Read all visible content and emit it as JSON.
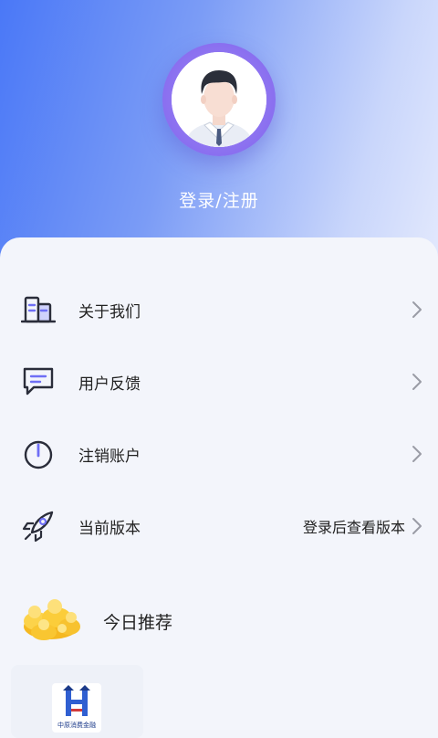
{
  "profile": {
    "login_label": "登录/注册"
  },
  "menu": {
    "items": [
      {
        "label": "关于我们",
        "icon": "building-icon"
      },
      {
        "label": "用户反馈",
        "icon": "chat-icon"
      },
      {
        "label": "注销账户",
        "icon": "power-icon"
      },
      {
        "label": "当前版本",
        "icon": "rocket-icon",
        "value": "登录后查看版本"
      }
    ]
  },
  "recommend": {
    "title": "今日推荐",
    "partner_logo_text": "中原消费金融"
  },
  "colors": {
    "header_start": "#4a78f7",
    "header_end": "#e3e9fd",
    "avatar_ring": "#8a6ff0",
    "icon_accent": "#6f6ff5"
  }
}
